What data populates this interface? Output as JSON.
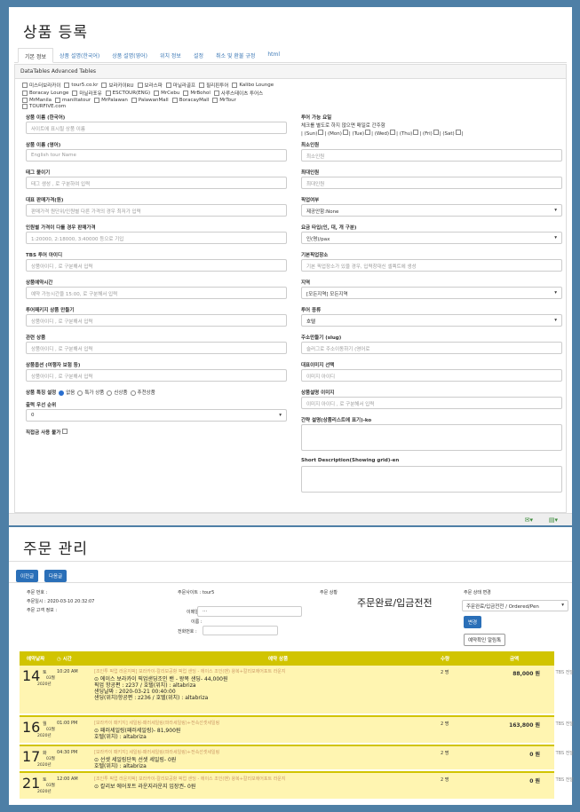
{
  "product": {
    "title": "상품 등록",
    "tabs": [
      "기본 정보",
      "상품 설명(한국어)",
      "상품 설명(영어)",
      "위치 정보",
      "설정",
      "취소 및 환불 규정",
      "html"
    ],
    "datatables_label": "DataTables Advanced Tables",
    "vendors": [
      "미스터보라카이",
      "tour5.co.kr",
      "보라카이RU",
      "보라스파",
      "마닐라골프",
      "필리핀투어",
      "Kalibo Lounge",
      "Boracay Lounge",
      "마닐라포유",
      "ESCTOUR(ENG)",
      "MrCebu",
      "MrBohol",
      "사루스테이츠 투어스",
      "MrManila",
      "maniltatour",
      "MrPalawan",
      "PalawanMall",
      "BoracayMall",
      "MrTour",
      "TOURFIVE.com"
    ],
    "left_fields": [
      {
        "label": "상품 이름 (한국어)",
        "placeholder": "사이트에 표시될 상품 이름"
      },
      {
        "label": "상품 이름 (영어)",
        "placeholder": "English tour Name"
      },
      {
        "label": "태그 붙이기",
        "placeholder": "태그 생성 , 로 구분하여 입력"
      },
      {
        "label": "대표 판매가격(원)",
        "placeholder": "판매가격 원단위/인원별 다른 가격의 경우 최저가 입력"
      },
      {
        "label": "인원별 가격이 다를 경우 판매가격",
        "placeholder": "1:20000, 2:18000, 3:40000 등으로 기입"
      },
      {
        "label": "TBS 투어 아이디",
        "placeholder": "상품아이디 , 로 구분해서 입력"
      },
      {
        "label": "상품예약시간",
        "placeholder": "예약 가능시간을 15:00, 로 구분해서 입력"
      },
      {
        "label": "투어패키지 상품 만들기",
        "placeholder": "상품아이디 , 로 구분해서 입력"
      },
      {
        "label": "관련 상품",
        "placeholder": "상품아이디 , 로 구분해서 입력"
      },
      {
        "label": "상품옵션 (여행자 보험 등)",
        "placeholder": "상품아이디 , 로 구분해서 입력"
      }
    ],
    "special_label": "상품 특징 설정",
    "special_options": [
      "없음",
      "특가 상품",
      "신상품",
      "추천상품"
    ],
    "priority_label": "출력 우선 순위",
    "priority_value": "0",
    "direct_label": "직접금 사용 불가",
    "right_tour_days_label": "투어 가능 요일",
    "right_tour_days_hint": "체크를 별도로 하지 않으면 매일로 간주함",
    "days": [
      "(Sun)",
      "(Mon)",
      "(Tue)",
      "(Wed)",
      "(Thu)",
      "(Fri)",
      "(Sat)"
    ],
    "right_fields": [
      {
        "label": "최소인원",
        "placeholder": "최소인원",
        "type": "input"
      },
      {
        "label": "최대인원",
        "placeholder": "최대인원",
        "type": "input"
      },
      {
        "label": "픽업여부",
        "placeholder": "제공안함:None",
        "type": "select"
      },
      {
        "label": "요금 타입(인, 대, 개 구분)",
        "placeholder": "인(명)/pax",
        "type": "select"
      },
      {
        "label": "기본픽업장소",
        "placeholder": "기본 픽업장소가 있을 경우, 입력창대신 셀렉트에 생성",
        "type": "input"
      },
      {
        "label": "지역",
        "placeholder": "[모든지역] 모든지역",
        "type": "select"
      },
      {
        "label": "투어 종류",
        "placeholder": "호텔",
        "type": "select"
      },
      {
        "label": "주소만들기 (slug)",
        "placeholder": "슬러그로 주소이동하기 (영어로",
        "type": "input"
      },
      {
        "label": "대표이미지 선택",
        "placeholder": "이미지 아이디",
        "type": "input"
      },
      {
        "label": "상품설명 이미지",
        "placeholder": "이미지 아이디 , 로 구분해서 입력",
        "type": "input"
      }
    ],
    "desc_ko_label": "간략 설명(상품리스트에 표기)-ko",
    "desc_en_label": "Short Description(Showing grid)-en"
  },
  "orders": {
    "title": "주문 관리",
    "prev_button": "이전글",
    "next_button": "다음글",
    "order_no_label": "주문 번호 :",
    "order_date_label": "주문일시 : 2020-03-10 20:32:07",
    "customer_label": "주문 고객 정보 :",
    "site_label": "주문사이트 : tour5",
    "email_label": "이메일 :",
    "email_value": "...",
    "name_label": "이름 :",
    "phone_label": "전화번호 :",
    "status_label": "주문 상황",
    "status_value": "주문완료/입금전전",
    "status_change_label": "주문 상태 변경",
    "status_select": "주문완료/입금전전 / Ordered/Pen",
    "change_button": "변경",
    "alarm_button": "예약확인 알림톡",
    "headers": [
      "예약날짜",
      "◷ 시간",
      "예약 상품",
      "수량",
      "금액"
    ],
    "rows": [
      {
        "day": "14",
        "dow": "토",
        "month": "03월",
        "year": "2020년",
        "time": "10:20 AM",
        "route": "[조인투 픽업 라운지픽] 보라카이-칼리보공항 픽업 샌딩 - 에이스 조인(밴) 왕복+칼리보에어포트 라운지",
        "lines": [
          "⊙ 에이스 보라카이 픽업샌딩조인 밴 - 왕복 샌딩- 44,000원",
          "픽업 항공편 : z237 / 호텔(위치) : altabriza",
          "샌딩날짜 : 2020-03-21 00:40:00",
          "샌딩(위치)항공편 : z236 / 호텔(위치) : altabriza"
        ],
        "qty": "2 명",
        "amount": "88,000 원",
        "tbs": "TBS 전달"
      },
      {
        "day": "16",
        "dow": "월",
        "month": "03월",
        "year": "2020년",
        "time": "01:00 PM",
        "route": "[보라카이 패키지] 세일링-패러세일링(파라세일링)+전속선셋세일링",
        "lines": [
          "⊙ 패러세일링(패러세일링)- 81,900원",
          "호텔(위치) : altabriza"
        ],
        "qty": "2 명",
        "amount": "163,800 원",
        "tbs": "TBS 전달"
      },
      {
        "day": "17",
        "dow": "화",
        "month": "03월",
        "year": "2020년",
        "time": "04:30 PM",
        "route": "[보라카이 패키지] 세일링-패러세일링(파라세일링)+전속선셋세일링",
        "lines": [
          "⊙ 선셋 세일링단독 선셋 세일링- 0원",
          "호텔(위치) : altabriza"
        ],
        "qty": "2 명",
        "amount": "0 원",
        "tbs": "TBS 전달"
      },
      {
        "day": "21",
        "dow": "토",
        "month": "03월",
        "year": "2020년",
        "time": "12:00 AM",
        "route": "[조인투 픽업 라운지픽] 보라카이-칼리보공항 픽업 샌딩 - 에이스 조인(밴) 왕복+칼리보에어포트 라운지",
        "lines": [
          "⊙ 칼리보 에어포트 라운지라운지 입장권- 0원"
        ],
        "qty": "2 명",
        "amount": "0 원",
        "tbs": "TBS 전달"
      }
    ]
  },
  "colors": {
    "background": "#4e7fa6",
    "accent": "#2a6fb8",
    "header_yellow": "#d1c400",
    "row_yellow": "#fff5b1"
  }
}
